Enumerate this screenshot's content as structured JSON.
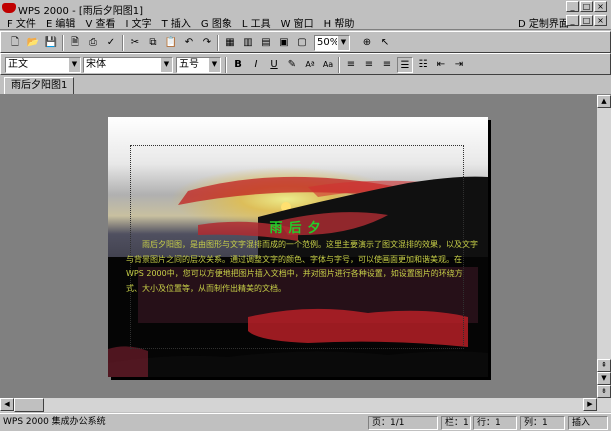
{
  "window": {
    "title": "WPS 2000 - [雨后夕阳图1]",
    "min_glyph": "_",
    "max_glyph": "□",
    "close_glyph": "×"
  },
  "menu": {
    "items": [
      "F 文件",
      "E 编辑",
      "V 查看",
      "I 文字",
      "T 插入",
      "G 图象",
      "L 工具",
      "W 窗口",
      "H 帮助"
    ],
    "right_items": [
      "D 定制界面"
    ]
  },
  "toolbar": {
    "zoom": "50%",
    "style": "正文",
    "font": "宋体",
    "size": "五号"
  },
  "tab": {
    "label": "雨后夕阳图1"
  },
  "document": {
    "heading": "雨后夕",
    "body": "雨后夕阳图，是由图形与文字混排而成的一个范例。这里主要演示了图文混排的效果，以及文字与背景图片之间的层次关系。通过调整文字的颜色、字体与字号，可以使画面更加和谐美观。在WPS 2000中，您可以方便地把图片插入文档中，并对图片进行各种设置，如设置图片的环绕方式、大小及位置等，从而制作出精美的文档。"
  },
  "status": {
    "app": "WPS 2000 集成办公系统",
    "page": "页：1/1",
    "column": "栏：1",
    "row": "行：1",
    "col": "列：1",
    "mode": "插入"
  },
  "colors": {
    "heading": "#22d02a",
    "body_text": "#c8d048",
    "sun": "#ff6030"
  },
  "icons": [
    "new-icon",
    "open-icon",
    "save-icon",
    "print-preview-icon",
    "print-icon",
    "spell-check-icon",
    "cut-icon",
    "copy-icon",
    "paste-icon",
    "undo-icon",
    "redo-icon",
    "table-icon",
    "picture-icon",
    "frame-icon",
    "textbox-icon",
    "zoom-icon",
    "pointer-icon",
    "bold-icon",
    "italic-icon",
    "underline-icon",
    "highlight-icon",
    "align-left-icon",
    "align-center-icon",
    "align-right-icon",
    "justify-icon"
  ]
}
